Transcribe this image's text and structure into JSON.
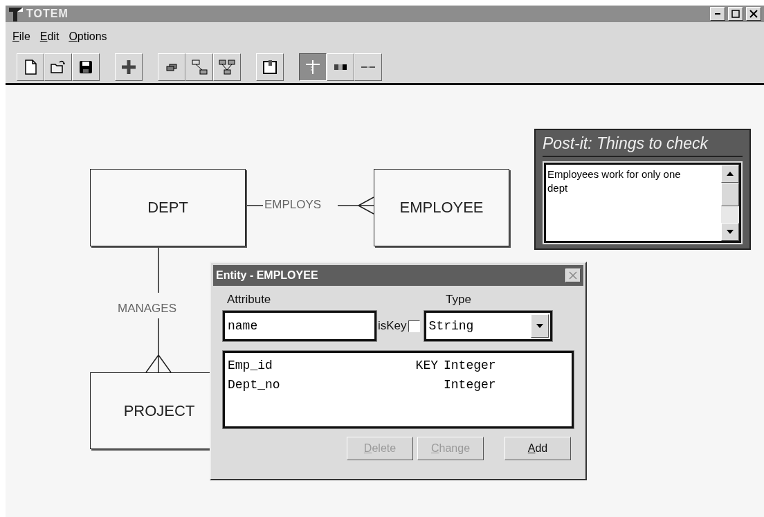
{
  "window": {
    "title": "TOTEM"
  },
  "menu": [
    {
      "label": "File"
    },
    {
      "label": "Edit"
    },
    {
      "label": "Options"
    }
  ],
  "toolbar": {
    "modes": [
      {
        "selected": true
      },
      {
        "selected": false
      },
      {
        "selected": false
      }
    ]
  },
  "diagram": {
    "entities": [
      {
        "name": "DEPT"
      },
      {
        "name": "EMPLOYEE"
      },
      {
        "name": "PROJECT"
      }
    ],
    "relationships": [
      {
        "label": "EMPLOYS"
      },
      {
        "label": "MANAGES"
      }
    ]
  },
  "postit": {
    "title": "Post-it: Things to check",
    "text": "Employees work for only one dept"
  },
  "dialog": {
    "title": "Entity - EMPLOYEE",
    "attribute_label": "Attribute",
    "type_label": "Type",
    "attribute_value": "name",
    "iskey_label": "isKey",
    "iskey_checked": false,
    "type_value": "String",
    "attributes": [
      {
        "name": "Emp_id",
        "key": "KEY",
        "type": "Integer"
      },
      {
        "name": "Dept_no",
        "type": "Integer"
      }
    ],
    "buttons": [
      {
        "label": "Delete",
        "disabled": true
      },
      {
        "label": "Change",
        "disabled": true
      },
      {
        "label": "Add",
        "disabled": false
      }
    ]
  }
}
